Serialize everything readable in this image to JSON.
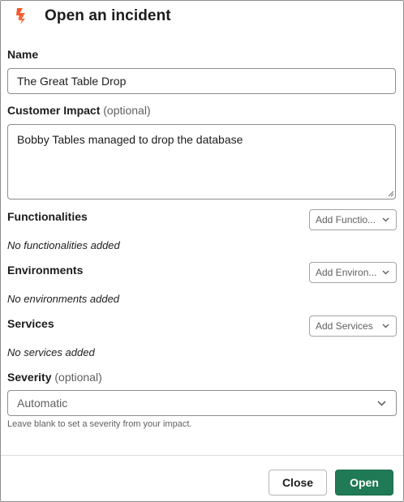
{
  "dialog": {
    "title": "Open an incident",
    "logo_icon": "firehydrant-logo",
    "brand_color": "#f35a2c"
  },
  "fields": {
    "name": {
      "label": "Name",
      "value": "The Great Table Drop"
    },
    "customer_impact": {
      "label": "Customer Impact",
      "optional": "(optional)",
      "value": "Bobby Tables managed to drop the database"
    },
    "functionalities": {
      "label": "Functionalities",
      "button": "Add Functio...",
      "empty": "No functionalities added"
    },
    "environments": {
      "label": "Environments",
      "button": "Add Environ...",
      "empty": "No environments added"
    },
    "services": {
      "label": "Services",
      "button": "Add Services",
      "empty": "No services added"
    },
    "severity": {
      "label": "Severity",
      "optional": "(optional)",
      "selected": "Automatic",
      "hint": "Leave blank to set a severity from your impact."
    }
  },
  "footer": {
    "close_label": "Close",
    "open_label": "Open",
    "open_color": "#1f7a55"
  }
}
